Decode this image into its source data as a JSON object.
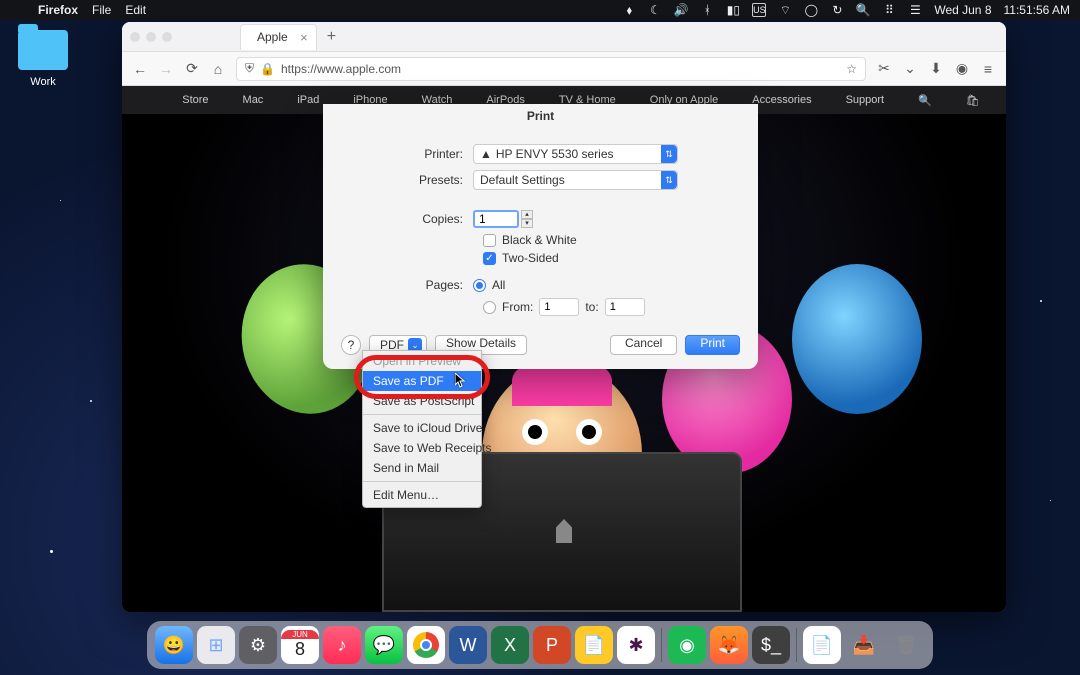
{
  "menubar": {
    "app": "Firefox",
    "file": "File",
    "edit": "Edit",
    "date": "Wed Jun 8",
    "time": "11:51:56 AM"
  },
  "desktop": {
    "folder_label": "Work"
  },
  "browser": {
    "tab_title": "Apple",
    "url": "https://www.apple.com"
  },
  "apple_nav": [
    "Store",
    "Mac",
    "iPad",
    "iPhone",
    "Watch",
    "AirPods",
    "TV & Home",
    "Only on Apple",
    "Accessories",
    "Support"
  ],
  "print": {
    "title": "Print",
    "printer_label": "Printer:",
    "printer_value": "HP ENVY 5530 series",
    "presets_label": "Presets:",
    "presets_value": "Default Settings",
    "copies_label": "Copies:",
    "copies_value": "1",
    "bw_label": "Black & White",
    "twosided_label": "Two-Sided",
    "pages_label": "Pages:",
    "pages_all": "All",
    "pages_from": "From:",
    "pages_from_val": "1",
    "pages_to": "to:",
    "pages_to_val": "1",
    "pdf_label": "PDF",
    "details_label": "Show Details",
    "cancel_label": "Cancel",
    "print_label": "Print",
    "help_label": "?"
  },
  "pdf_menu": {
    "open_preview": "Open in Preview",
    "save_pdf": "Save as PDF",
    "save_ps": "Save as PostScript",
    "icloud": "Save to iCloud Drive",
    "web_receipts": "Save to Web Receipts",
    "mail": "Send in Mail",
    "edit_menu": "Edit Menu…"
  },
  "input_lang": "US"
}
